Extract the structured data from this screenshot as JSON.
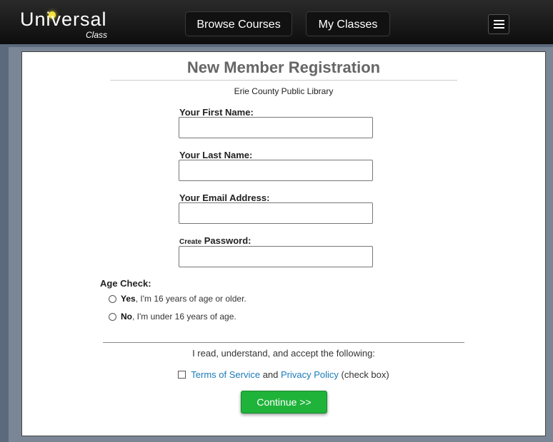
{
  "header": {
    "logo_main": "Universal",
    "logo_sub": "Class",
    "nav": [
      {
        "label": "Browse Courses"
      },
      {
        "label": "My Classes"
      }
    ]
  },
  "form": {
    "title": "New Member Registration",
    "library": "Erie County Public Library",
    "fields": [
      {
        "label": "Your First Name:",
        "value": ""
      },
      {
        "label": "Your Last Name:",
        "value": ""
      },
      {
        "label": "Your Email Address:",
        "value": ""
      },
      {
        "label_small": "Create",
        "label": " Password:",
        "value": ""
      }
    ],
    "age_check": {
      "label": "Age Check:",
      "options": [
        {
          "bold": "Yes",
          "text": ", I'm 16 years of age or older."
        },
        {
          "bold": "No",
          "text": ", I'm under 16 years of age."
        }
      ]
    },
    "accept_text": "I read, understand, and accept the following:",
    "terms": {
      "tos": "Terms of Service",
      "and": " and ",
      "privacy": "Privacy Policy",
      "suffix": " (check box)"
    },
    "continue_label": "Continue >>"
  },
  "colors": {
    "accent_green": "#1fb33a",
    "link_blue": "#1a7bb8"
  }
}
